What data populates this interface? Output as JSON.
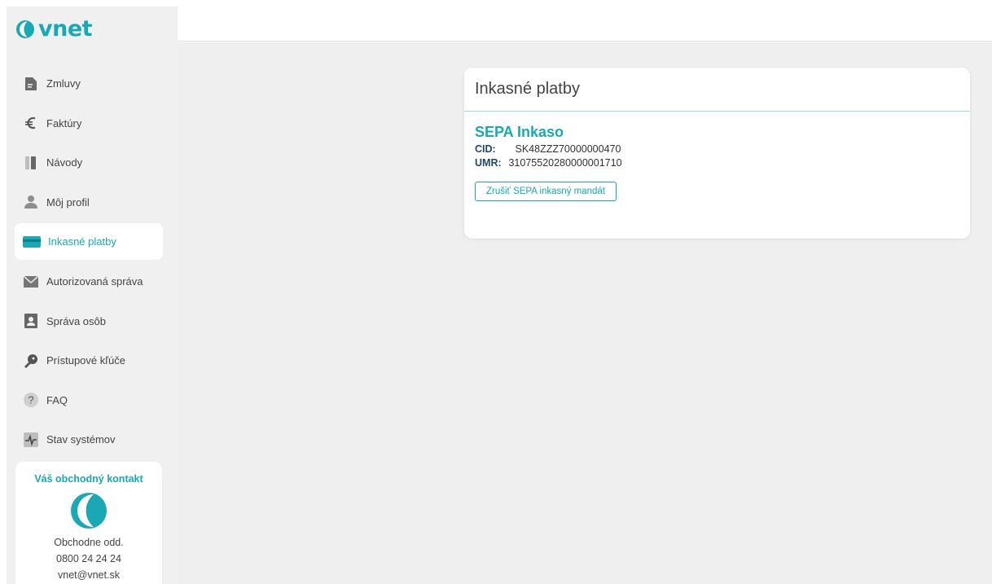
{
  "brand": {
    "name": "vnet",
    "accent": "#1aa8b4"
  },
  "sidebar": {
    "items": [
      {
        "label": "Zmluvy",
        "icon": "document-icon"
      },
      {
        "label": "Faktúry",
        "icon": "euro-icon"
      },
      {
        "label": "Návody",
        "icon": "book-icon"
      },
      {
        "label": "Môj profil",
        "icon": "user-icon"
      },
      {
        "label": "Inkasné platby",
        "icon": "card-icon",
        "active": true
      },
      {
        "label": "Autorizovaná správa",
        "icon": "envelope-icon"
      },
      {
        "label": "Správa osôb",
        "icon": "person-card-icon"
      },
      {
        "label": "Prístupové kľúče",
        "icon": "key-icon"
      },
      {
        "label": "FAQ",
        "icon": "question-icon"
      },
      {
        "label": "Stav systémov",
        "icon": "pulse-icon"
      }
    ]
  },
  "contact": {
    "title": "Váš obchodný kontakt",
    "name": "Obchodne odd.",
    "phone": "0800 24 24 24",
    "email": "vnet@vnet.sk"
  },
  "card": {
    "title": "Inkasné platby",
    "section_title": "SEPA Inkaso",
    "cid_label": "CID:",
    "cid_value": "SK48ZZZ70000000470",
    "umr_label": "UMR:",
    "umr_value": "31075520280000001710",
    "cancel_button": "Zrušiť SEPA inkasný mandát"
  }
}
